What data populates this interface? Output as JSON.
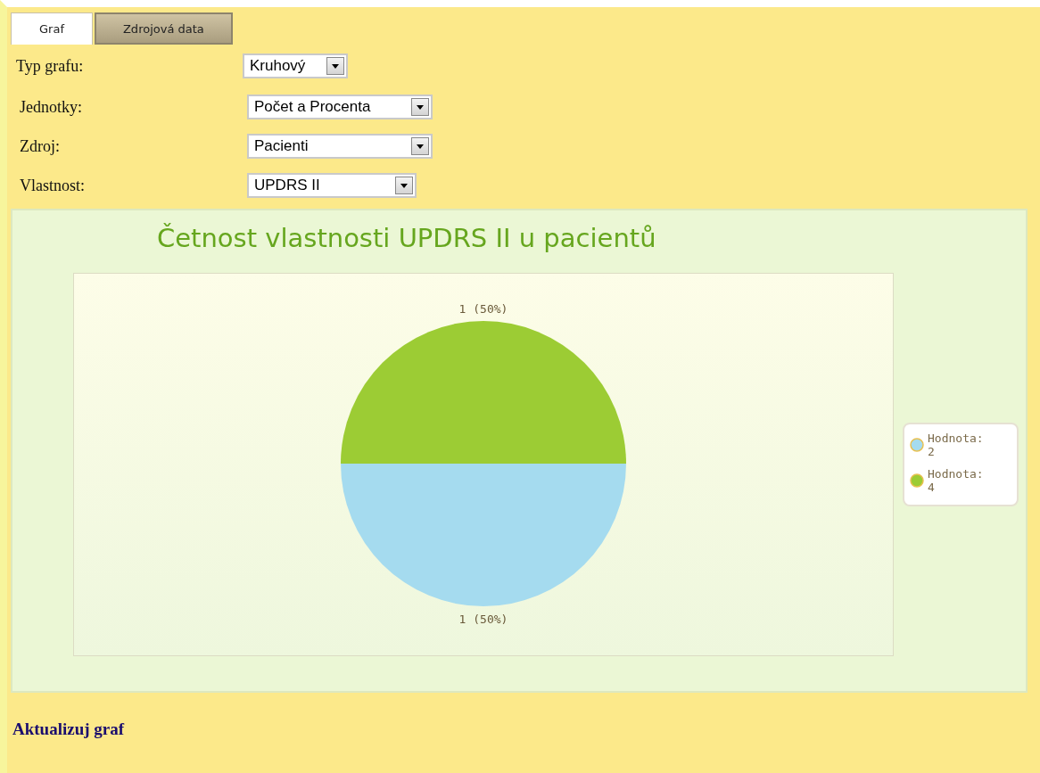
{
  "tabs": [
    {
      "label": "Graf",
      "selected": true
    },
    {
      "label": "Zdrojová data",
      "selected": false
    }
  ],
  "form": [
    {
      "label": "Typ grafu:",
      "value": "Kruhový"
    },
    {
      "label": "Jednotky:",
      "value": "Počet a Procenta"
    },
    {
      "label": "Zdroj:",
      "value": "Pacienti"
    },
    {
      "label": "Vlastnost:",
      "value": "UPDRS II"
    }
  ],
  "chart": {
    "chart_data": {
      "type": "pie",
      "title": "Četnost vlastnosti UPDRS II u pacientů",
      "categories": [
        "Hodnota: 2",
        "Hodnota: 4"
      ],
      "values": [
        1,
        1
      ],
      "value_labels": [
        "1 (50%)",
        "1 (50%)"
      ],
      "colors": [
        "#a5dbef",
        "#9ccc34"
      ],
      "legend": "right"
    }
  },
  "update_link": "Aktualizuj graf"
}
